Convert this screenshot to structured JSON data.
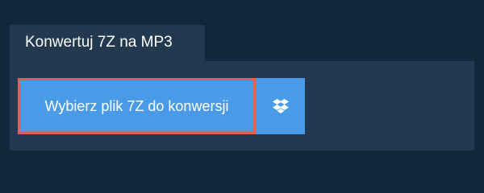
{
  "tab": {
    "label": "Konwertuj 7Z na MP3"
  },
  "upload": {
    "choose_label": "Wybierz plik 7Z do konwersji",
    "dropbox_icon": "dropbox-icon"
  },
  "colors": {
    "page_background": "#13273c",
    "panel_background": "#233950",
    "button_blue": "#4a9be7",
    "highlight_border": "#e0605e",
    "text": "#ffffff"
  }
}
